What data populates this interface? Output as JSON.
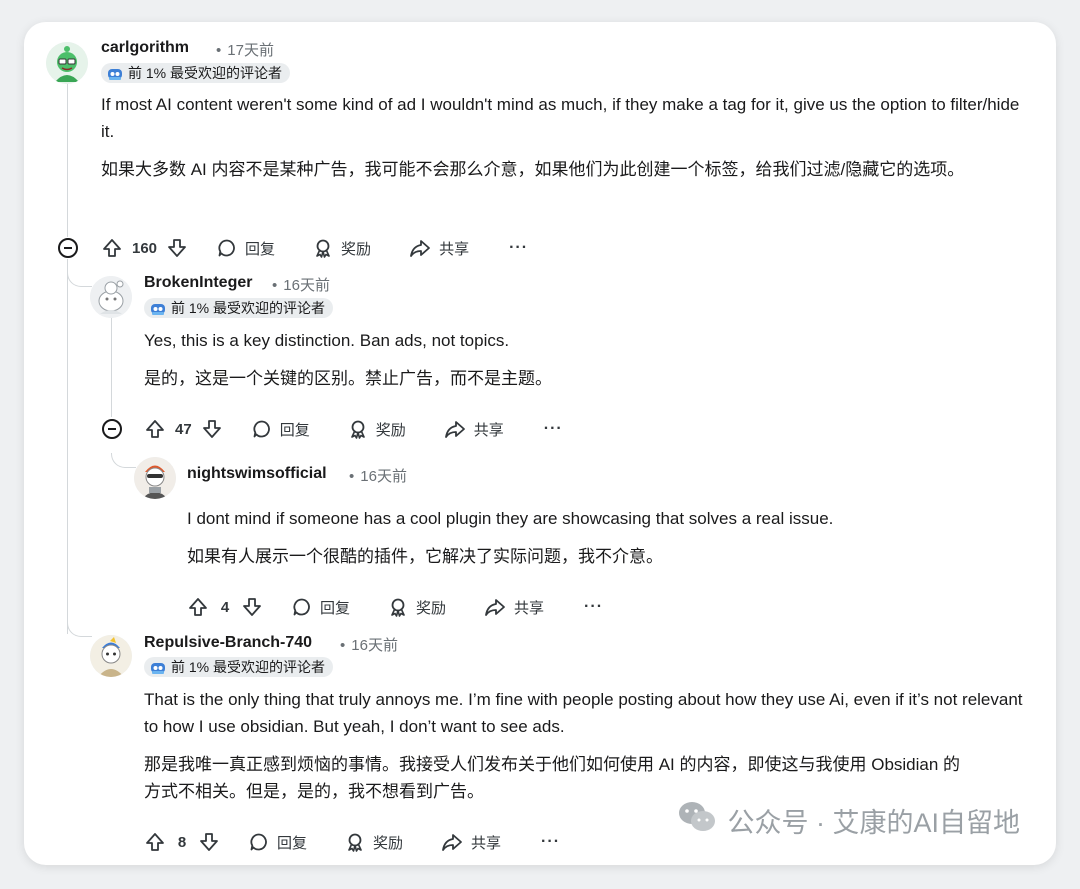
{
  "comments": [
    {
      "author": "carlgorithm",
      "time": "17天前",
      "flair": "前 1% 最受欢迎的评论者",
      "text_en": "If most AI content weren't some kind of ad I wouldn't mind as much, if they make a tag for it, give us the option to filter/hide it.",
      "text_zh": "如果大多数 AI 内容不是某种广告，我可能不会那么介意，如果他们为此创建一个标签，给我们过滤/隐藏它的选项。",
      "votes": "160",
      "reply": "回复",
      "award": "奖励",
      "share": "共享",
      "more": "···"
    },
    {
      "author": "BrokenInteger",
      "time": "16天前",
      "flair": "前 1% 最受欢迎的评论者",
      "text_en": "Yes, this is a key distinction. Ban ads, not topics.",
      "text_zh": "是的，这是一个关键的区别。禁止广告，而不是主题。",
      "votes": "47",
      "reply": "回复",
      "award": "奖励",
      "share": "共享",
      "more": "···"
    },
    {
      "author": "nightswimsofficial",
      "time": "16天前",
      "text_en": "I dont mind if someone has a cool plugin they are showcasing that solves a real issue.",
      "text_zh": "如果有人展示一个很酷的插件，它解决了实际问题，我不介意。",
      "votes": "4",
      "reply": "回复",
      "award": "奖励",
      "share": "共享",
      "more": "···"
    },
    {
      "author": "Repulsive-Branch-740",
      "time": "16天前",
      "flair": "前 1% 最受欢迎的评论者",
      "text_en": "That is the only thing that truly annoys me. I’m fine with people posting about how they use Ai, even if it’s not relevant to how I use obsidian. But yeah, I don’t want to see ads.",
      "text_zh": "那是我唯一真正感到烦恼的事情。我接受人们发布关于他们如何使用 AI 的内容，即使这与我使用 Obsidian 的方式不相关。但是，是的，我不想看到广告。",
      "votes": "8",
      "reply": "回复",
      "award": "奖励",
      "share": "共享",
      "more": "···"
    }
  ],
  "separator": "•",
  "watermark": "公众号 · 艾康的AI自留地",
  "icons": {
    "upvote": "upvote-icon",
    "downvote": "downvote-icon",
    "reply": "comment-bubble-icon",
    "award": "award-ribbon-icon",
    "share": "share-arrow-icon",
    "collapse": "collapse-minus-icon",
    "flair": "flair-badge-icon",
    "watermark": "wechat-logo-icon"
  }
}
